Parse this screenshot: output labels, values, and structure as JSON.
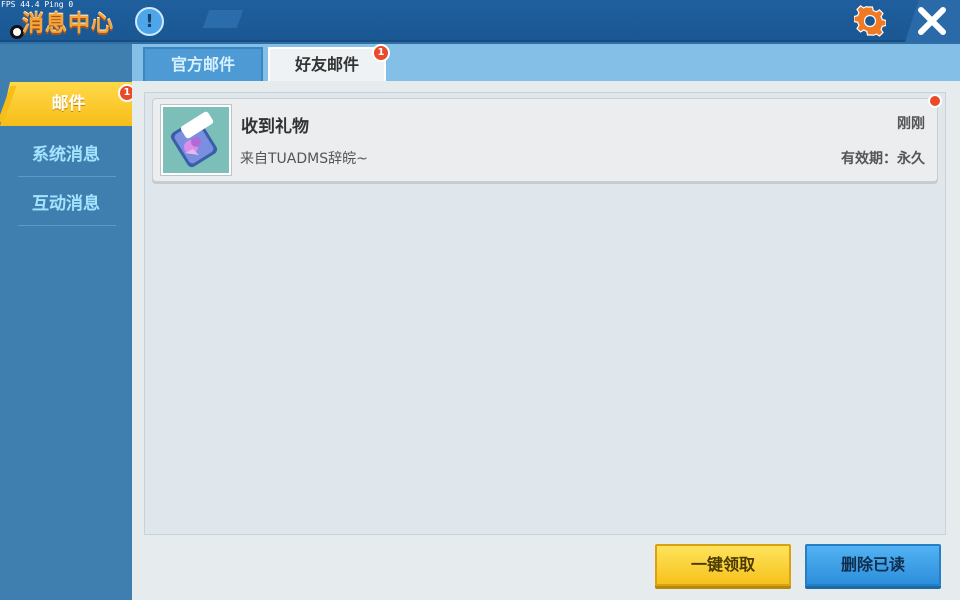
{
  "overlay": {
    "fps_text": "FPS 44.4  Ping 0"
  },
  "header": {
    "title": "消息中心",
    "info_glyph": "!"
  },
  "sidebar": {
    "items": [
      {
        "label": "邮件",
        "active": true,
        "badge": "1"
      },
      {
        "label": "系统消息",
        "active": false
      },
      {
        "label": "互动消息",
        "active": false
      }
    ]
  },
  "tabs": [
    {
      "label": "官方邮件",
      "active": false
    },
    {
      "label": "好友邮件",
      "active": true,
      "badge": "1"
    }
  ],
  "mail_list": [
    {
      "title": "收到礼物",
      "sender": "来自TUADMS辞皖~",
      "time": "刚刚",
      "expiry": "有效期：永久",
      "unread": true,
      "icon": "gift-ticket-icon"
    }
  ],
  "actions": {
    "claim_all": "一键领取",
    "delete_read": "删除已读"
  },
  "colors": {
    "accent_orange": "#f6a53a",
    "active_yellow": "#f7bd18",
    "badge_red": "#e84a2a",
    "primary_blue": "#2d8fdc"
  }
}
